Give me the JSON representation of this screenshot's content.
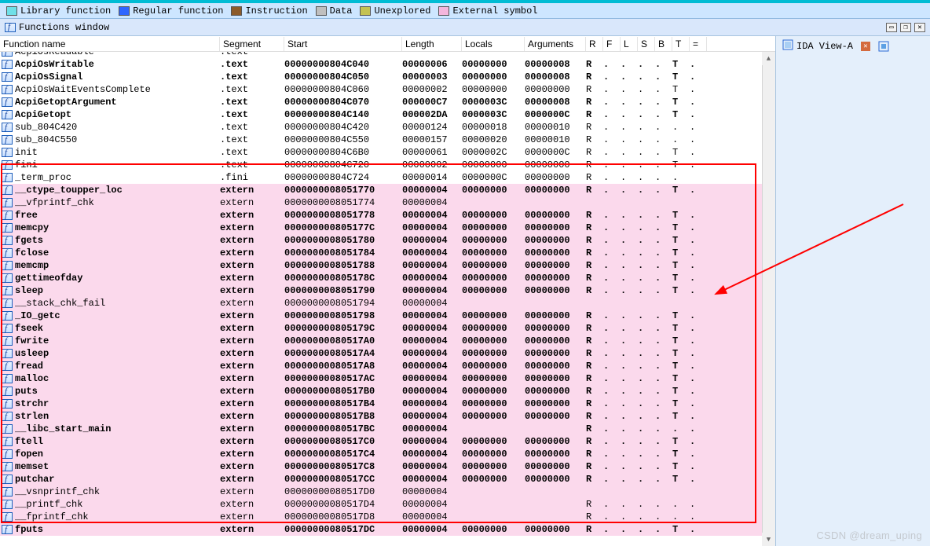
{
  "legend": [
    {
      "label": "Library function",
      "color": "#6fe0e8"
    },
    {
      "label": "Regular function",
      "color": "#2f66ff"
    },
    {
      "label": "Instruction",
      "color": "#8c5b2a"
    },
    {
      "label": "Data",
      "color": "#bfbfbf"
    },
    {
      "label": "Unexplored",
      "color": "#c4c252"
    },
    {
      "label": "External symbol",
      "color": "#f4b6dd"
    }
  ],
  "window_title": "Functions window",
  "right_tab": {
    "label": "IDA View-A"
  },
  "watermark": "CSDN @dream_uping",
  "columns": [
    "Function name",
    "Segment",
    "Start",
    "Length",
    "Locals",
    "Arguments",
    "R",
    "F",
    "L",
    "S",
    "B",
    "T",
    "="
  ],
  "rows": [
    {
      "name": "AcpiOsReadable",
      "seg": ".text",
      "start": "",
      "len": "",
      "loc": "",
      "arg": "",
      "flags": [
        "",
        "",
        "",
        "",
        "",
        "",
        ""
      ],
      "bold": false,
      "pink": false,
      "cut": true
    },
    {
      "name": "AcpiOsWritable",
      "seg": ".text",
      "start": "00000000804C040",
      "len": "00000006",
      "loc": "00000000",
      "arg": "00000008",
      "flags": [
        "R",
        ".",
        ".",
        ".",
        ".",
        "T",
        "."
      ],
      "bold": true,
      "pink": false
    },
    {
      "name": "AcpiOsSignal",
      "seg": ".text",
      "start": "00000000804C050",
      "len": "00000003",
      "loc": "00000000",
      "arg": "00000008",
      "flags": [
        "R",
        ".",
        ".",
        ".",
        ".",
        "T",
        "."
      ],
      "bold": true,
      "pink": false
    },
    {
      "name": "AcpiOsWaitEventsComplete",
      "seg": ".text",
      "start": "00000000804C060",
      "len": "00000002",
      "loc": "00000000",
      "arg": "00000000",
      "flags": [
        "R",
        ".",
        ".",
        ".",
        ".",
        "T",
        "."
      ],
      "bold": false,
      "pink": false
    },
    {
      "name": "AcpiGetoptArgument",
      "seg": ".text",
      "start": "00000000804C070",
      "len": "000000C7",
      "loc": "0000003C",
      "arg": "00000008",
      "flags": [
        "R",
        ".",
        ".",
        ".",
        ".",
        "T",
        "."
      ],
      "bold": true,
      "pink": false
    },
    {
      "name": "AcpiGetopt",
      "seg": ".text",
      "start": "00000000804C140",
      "len": "000002DA",
      "loc": "0000003C",
      "arg": "0000000C",
      "flags": [
        "R",
        ".",
        ".",
        ".",
        ".",
        "T",
        "."
      ],
      "bold": true,
      "pink": false
    },
    {
      "name": "sub_804C420",
      "seg": ".text",
      "start": "00000000804C420",
      "len": "00000124",
      "loc": "00000018",
      "arg": "00000010",
      "flags": [
        "R",
        ".",
        ".",
        ".",
        ".",
        ".",
        "."
      ],
      "bold": false,
      "pink": false
    },
    {
      "name": "sub_804C550",
      "seg": ".text",
      "start": "00000000804C550",
      "len": "00000157",
      "loc": "00000020",
      "arg": "00000010",
      "flags": [
        "R",
        ".",
        ".",
        ".",
        ".",
        ".",
        "."
      ],
      "bold": false,
      "pink": false
    },
    {
      "name": "init",
      "seg": ".text",
      "start": "00000000804C6B0",
      "len": "00000061",
      "loc": "0000002C",
      "arg": "0000000C",
      "flags": [
        "R",
        ".",
        ".",
        ".",
        ".",
        "T",
        "."
      ],
      "bold": false,
      "pink": false
    },
    {
      "name": "fini",
      "seg": ".text",
      "start": "00000000804C720",
      "len": "00000002",
      "loc": "00000000",
      "arg": "00000000",
      "flags": [
        "R",
        ".",
        ".",
        ".",
        ".",
        "T",
        "."
      ],
      "bold": false,
      "pink": false
    },
    {
      "name": "_term_proc",
      "seg": ".fini",
      "start": "00000000804C724",
      "len": "00000014",
      "loc": "0000000C",
      "arg": "00000000",
      "flags": [
        "R",
        ".",
        ".",
        ".",
        ".",
        ".",
        ""
      ],
      "bold": false,
      "pink": false,
      "cutbottom": true
    },
    {
      "name": "__ctype_toupper_loc",
      "seg": "extern",
      "start": "0000000008051770",
      "len": "00000004",
      "loc": "00000000",
      "arg": "00000000",
      "flags": [
        "R",
        ".",
        ".",
        ".",
        ".",
        "T",
        "."
      ],
      "bold": true,
      "pink": true
    },
    {
      "name": "__vfprintf_chk",
      "seg": "extern",
      "start": "0000000008051774",
      "len": "00000004",
      "loc": "",
      "arg": "",
      "flags": [
        "",
        "",
        "",
        "",
        "",
        "",
        ""
      ],
      "bold": false,
      "pink": true
    },
    {
      "name": "free",
      "seg": "extern",
      "start": "0000000008051778",
      "len": "00000004",
      "loc": "00000000",
      "arg": "00000000",
      "flags": [
        "R",
        ".",
        ".",
        ".",
        ".",
        "T",
        "."
      ],
      "bold": true,
      "pink": true
    },
    {
      "name": "memcpy",
      "seg": "extern",
      "start": "000000000805177C",
      "len": "00000004",
      "loc": "00000000",
      "arg": "00000000",
      "flags": [
        "R",
        ".",
        ".",
        ".",
        ".",
        "T",
        "."
      ],
      "bold": true,
      "pink": true
    },
    {
      "name": "fgets",
      "seg": "extern",
      "start": "0000000008051780",
      "len": "00000004",
      "loc": "00000000",
      "arg": "00000000",
      "flags": [
        "R",
        ".",
        ".",
        ".",
        ".",
        "T",
        "."
      ],
      "bold": true,
      "pink": true
    },
    {
      "name": "fclose",
      "seg": "extern",
      "start": "0000000008051784",
      "len": "00000004",
      "loc": "00000000",
      "arg": "00000000",
      "flags": [
        "R",
        ".",
        ".",
        ".",
        ".",
        "T",
        "."
      ],
      "bold": true,
      "pink": true
    },
    {
      "name": "memcmp",
      "seg": "extern",
      "start": "0000000008051788",
      "len": "00000004",
      "loc": "00000000",
      "arg": "00000000",
      "flags": [
        "R",
        ".",
        ".",
        ".",
        ".",
        "T",
        "."
      ],
      "bold": true,
      "pink": true
    },
    {
      "name": "gettimeofday",
      "seg": "extern",
      "start": "000000000805178C",
      "len": "00000004",
      "loc": "00000000",
      "arg": "00000000",
      "flags": [
        "R",
        ".",
        ".",
        ".",
        ".",
        "T",
        "."
      ],
      "bold": true,
      "pink": true
    },
    {
      "name": "sleep",
      "seg": "extern",
      "start": "0000000008051790",
      "len": "00000004",
      "loc": "00000000",
      "arg": "00000000",
      "flags": [
        "R",
        ".",
        ".",
        ".",
        ".",
        "T",
        "."
      ],
      "bold": true,
      "pink": true
    },
    {
      "name": "__stack_chk_fail",
      "seg": "extern",
      "start": "0000000008051794",
      "len": "00000004",
      "loc": "",
      "arg": "",
      "flags": [
        "",
        "",
        "",
        "",
        "",
        "",
        ""
      ],
      "bold": false,
      "pink": true
    },
    {
      "name": "_IO_getc",
      "seg": "extern",
      "start": "0000000008051798",
      "len": "00000004",
      "loc": "00000000",
      "arg": "00000000",
      "flags": [
        "R",
        ".",
        ".",
        ".",
        ".",
        "T",
        "."
      ],
      "bold": true,
      "pink": true
    },
    {
      "name": "fseek",
      "seg": "extern",
      "start": "000000000805179C",
      "len": "00000004",
      "loc": "00000000",
      "arg": "00000000",
      "flags": [
        "R",
        ".",
        ".",
        ".",
        ".",
        "T",
        "."
      ],
      "bold": true,
      "pink": true
    },
    {
      "name": "fwrite",
      "seg": "extern",
      "start": "00000000080517A0",
      "len": "00000004",
      "loc": "00000000",
      "arg": "00000000",
      "flags": [
        "R",
        ".",
        ".",
        ".",
        ".",
        "T",
        "."
      ],
      "bold": true,
      "pink": true
    },
    {
      "name": "usleep",
      "seg": "extern",
      "start": "00000000080517A4",
      "len": "00000004",
      "loc": "00000000",
      "arg": "00000000",
      "flags": [
        "R",
        ".",
        ".",
        ".",
        ".",
        "T",
        "."
      ],
      "bold": true,
      "pink": true
    },
    {
      "name": "fread",
      "seg": "extern",
      "start": "00000000080517A8",
      "len": "00000004",
      "loc": "00000000",
      "arg": "00000000",
      "flags": [
        "R",
        ".",
        ".",
        ".",
        ".",
        "T",
        "."
      ],
      "bold": true,
      "pink": true
    },
    {
      "name": "malloc",
      "seg": "extern",
      "start": "00000000080517AC",
      "len": "00000004",
      "loc": "00000000",
      "arg": "00000000",
      "flags": [
        "R",
        ".",
        ".",
        ".",
        ".",
        "T",
        "."
      ],
      "bold": true,
      "pink": true
    },
    {
      "name": "puts",
      "seg": "extern",
      "start": "00000000080517B0",
      "len": "00000004",
      "loc": "00000000",
      "arg": "00000000",
      "flags": [
        "R",
        ".",
        ".",
        ".",
        ".",
        "T",
        "."
      ],
      "bold": true,
      "pink": true
    },
    {
      "name": "strchr",
      "seg": "extern",
      "start": "00000000080517B4",
      "len": "00000004",
      "loc": "00000000",
      "arg": "00000000",
      "flags": [
        "R",
        ".",
        ".",
        ".",
        ".",
        "T",
        "."
      ],
      "bold": true,
      "pink": true
    },
    {
      "name": "strlen",
      "seg": "extern",
      "start": "00000000080517B8",
      "len": "00000004",
      "loc": "00000000",
      "arg": "00000000",
      "flags": [
        "R",
        ".",
        ".",
        ".",
        ".",
        "T",
        "."
      ],
      "bold": true,
      "pink": true
    },
    {
      "name": "__libc_start_main",
      "seg": "extern",
      "start": "00000000080517BC",
      "len": "00000004",
      "loc": "",
      "arg": "",
      "flags": [
        "R",
        ".",
        ".",
        ".",
        ".",
        ".",
        "."
      ],
      "bold": true,
      "pink": true
    },
    {
      "name": "ftell",
      "seg": "extern",
      "start": "00000000080517C0",
      "len": "00000004",
      "loc": "00000000",
      "arg": "00000000",
      "flags": [
        "R",
        ".",
        ".",
        ".",
        ".",
        "T",
        "."
      ],
      "bold": true,
      "pink": true
    },
    {
      "name": "fopen",
      "seg": "extern",
      "start": "00000000080517C4",
      "len": "00000004",
      "loc": "00000000",
      "arg": "00000000",
      "flags": [
        "R",
        ".",
        ".",
        ".",
        ".",
        "T",
        "."
      ],
      "bold": true,
      "pink": true
    },
    {
      "name": "memset",
      "seg": "extern",
      "start": "00000000080517C8",
      "len": "00000004",
      "loc": "00000000",
      "arg": "00000000",
      "flags": [
        "R",
        ".",
        ".",
        ".",
        ".",
        "T",
        "."
      ],
      "bold": true,
      "pink": true
    },
    {
      "name": "putchar",
      "seg": "extern",
      "start": "00000000080517CC",
      "len": "00000004",
      "loc": "00000000",
      "arg": "00000000",
      "flags": [
        "R",
        ".",
        ".",
        ".",
        ".",
        "T",
        "."
      ],
      "bold": true,
      "pink": true
    },
    {
      "name": "__vsnprintf_chk",
      "seg": "extern",
      "start": "00000000080517D0",
      "len": "00000004",
      "loc": "",
      "arg": "",
      "flags": [
        "",
        "",
        "",
        "",
        "",
        "",
        ""
      ],
      "bold": false,
      "pink": true
    },
    {
      "name": "__printf_chk",
      "seg": "extern",
      "start": "00000000080517D4",
      "len": "00000004",
      "loc": "",
      "arg": "",
      "flags": [
        "R",
        ".",
        ".",
        ".",
        ".",
        ".",
        "."
      ],
      "bold": false,
      "pink": true
    },
    {
      "name": "__fprintf_chk",
      "seg": "extern",
      "start": "00000000080517D8",
      "len": "00000004",
      "loc": "",
      "arg": "",
      "flags": [
        "R",
        ".",
        ".",
        ".",
        ".",
        ".",
        "."
      ],
      "bold": false,
      "pink": true
    },
    {
      "name": "fputs",
      "seg": "extern",
      "start": "00000000080517DC",
      "len": "00000004",
      "loc": "00000000",
      "arg": "00000000",
      "flags": [
        "R",
        ".",
        ".",
        ".",
        ".",
        "T",
        "."
      ],
      "bold": true,
      "pink": true
    }
  ]
}
